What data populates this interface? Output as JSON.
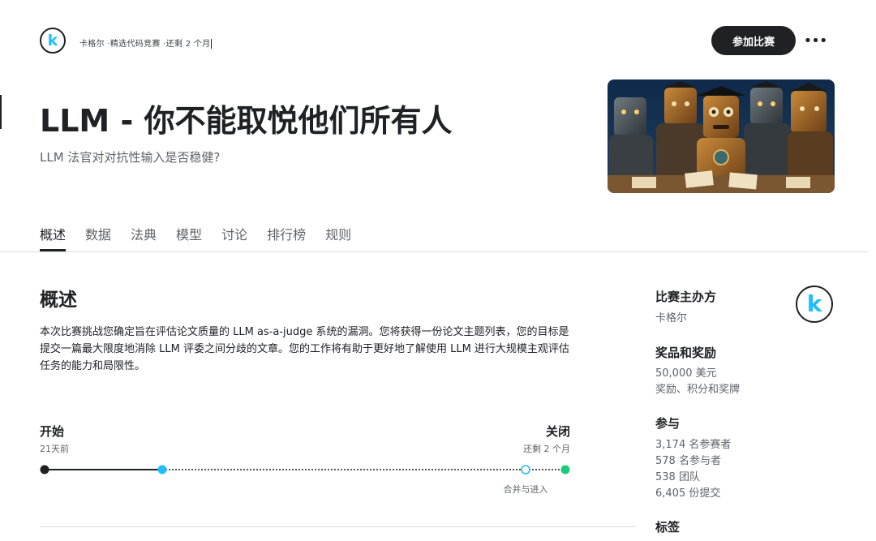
{
  "header": {
    "logo_letter": "k",
    "breadcrumb": "卡格尔 ·精选代码竞赛 ·还剩 2 个月",
    "join_label": "参加比赛",
    "more_label": "•••"
  },
  "competition": {
    "title": "LLM - 你不能取悦他们所有人",
    "subtitle": "LLM 法官对对抗性输入是否稳健?"
  },
  "tabs": [
    {
      "label": "概述",
      "active": true
    },
    {
      "label": "数据",
      "active": false
    },
    {
      "label": "法典",
      "active": false
    },
    {
      "label": "模型",
      "active": false
    },
    {
      "label": "讨论",
      "active": false
    },
    {
      "label": "排行榜",
      "active": false
    },
    {
      "label": "规则",
      "active": false
    }
  ],
  "overview": {
    "heading": "概述",
    "description": "本次比赛挑战您确定旨在评估论文质量的 LLM as-a-judge 系统的漏洞。您将获得一份论文主题列表，您的目标是提交一篇最大限度地消除 LLM 评委之间分歧的文章。您的工作将有助于更好地了解使用 LLM 进行大规模主观评估任务的能力和局限性。"
  },
  "timeline": {
    "start_label": "开始",
    "start_sub": "21天前",
    "end_label": "关闭",
    "end_sub": "还剩 2 个月",
    "merge_label": "合并与进入",
    "colors": {
      "dark": "#202124",
      "current": "#20beff",
      "end": "#1ec97a"
    }
  },
  "sidebar": {
    "organizer_heading": "比赛主办方",
    "organizer_name": "卡格尔",
    "organizer_logo_letter": "k",
    "prizes_heading": "奖品和奖励",
    "prize_amount": "50,000 美元",
    "prize_types": "奖励、积分和奖牌",
    "participation_heading": "参与",
    "entrants": "3,174 名参赛者",
    "participants": "578 名参与者",
    "teams": "538 团队",
    "submissions": "6,405 份提交",
    "tags_heading": "标签"
  }
}
